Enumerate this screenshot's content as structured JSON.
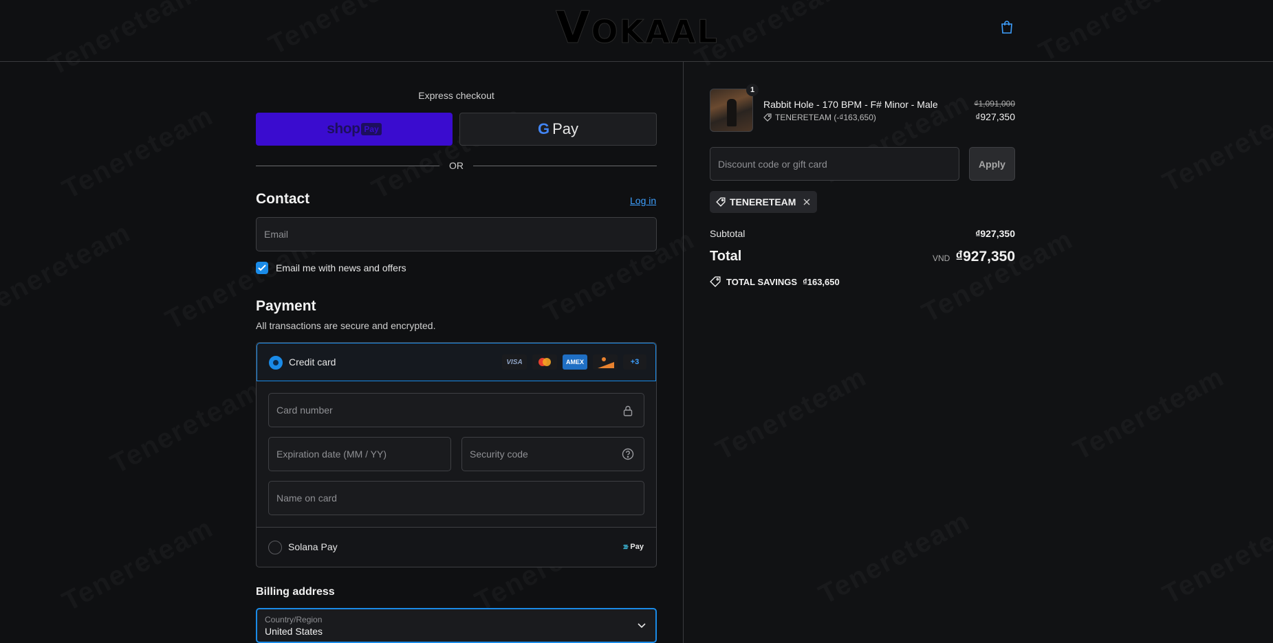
{
  "watermark": "Tenereteam",
  "header": {
    "logo": "OKAAL",
    "logo_initial": "V"
  },
  "express": {
    "label": "Express checkout",
    "shop_label": "shop",
    "shop_pay_label": "Pay",
    "gpay_g": "G",
    "gpay_label": "Pay",
    "or_label": "OR"
  },
  "contact": {
    "heading": "Contact",
    "login_label": "Log in",
    "email_placeholder": "Email",
    "news_label": "Email me with news and offers",
    "news_checked": true
  },
  "payment": {
    "heading": "Payment",
    "subtitle": "All transactions are secure and encrypted.",
    "credit_card_label": "Credit card",
    "card_brands": [
      "VISA",
      "",
      "AMEX",
      "",
      "+3"
    ],
    "card_number_placeholder": "Card number",
    "expiration_placeholder": "Expiration date (MM / YY)",
    "security_placeholder": "Security code",
    "name_placeholder": "Name on card",
    "solana_label": "Solana Pay",
    "solana_badge": "Pay"
  },
  "billing": {
    "heading": "Billing address",
    "country_label": "Country/Region",
    "country_value": "United States"
  },
  "order": {
    "quantity": "1",
    "product_title": "Rabbit Hole - 170 BPM - F# Minor - Male",
    "product_discount": "TENERETEAM (-₫163,650)",
    "price_original": "₫1,091,000",
    "price_current": "₫927,350",
    "discount_placeholder": "Discount code or gift card",
    "apply_label": "Apply",
    "applied_code": "TENERETEAM",
    "subtotal_label": "Subtotal",
    "subtotal_value": "₫927,350",
    "total_label": "Total",
    "currency": "VND",
    "total_value": "₫927,350",
    "savings_label": "TOTAL SAVINGS",
    "savings_value": "₫163,650"
  },
  "colors": {
    "accent": "#1a8be8",
    "shop_pay": "#3a0ccf",
    "link": "#3ea0ff"
  }
}
